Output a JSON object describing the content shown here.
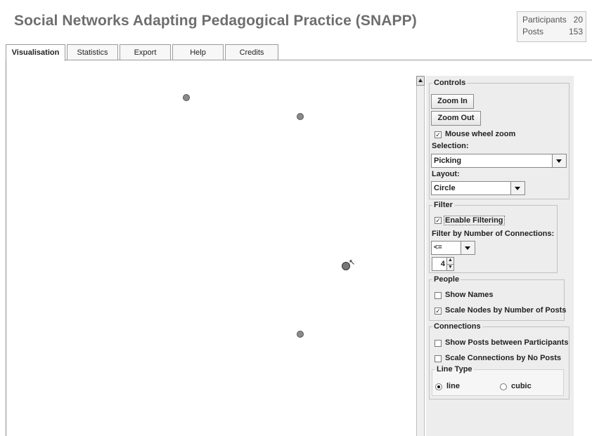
{
  "header": {
    "title": "Social Networks Adapting Pedagogical Practice (SNAPP)",
    "stats": {
      "participants_label": "Participants",
      "participants_value": "20",
      "posts_label": "Posts",
      "posts_value": "153"
    }
  },
  "tabs": [
    {
      "label": "Visualisation",
      "active": true
    },
    {
      "label": "Statistics",
      "active": false
    },
    {
      "label": "Export",
      "active": false
    },
    {
      "label": "Help",
      "active": false
    },
    {
      "label": "Credits",
      "active": false
    }
  ],
  "controls": {
    "legend": "Controls",
    "zoom_in": "Zoom In",
    "zoom_out": "Zoom Out",
    "mouse_wheel_zoom": {
      "label": "Mouse wheel zoom",
      "checked": true
    },
    "selection_label": "Selection:",
    "selection_value": "Picking",
    "layout_label": "Layout:",
    "layout_value": "Circle"
  },
  "filter": {
    "legend": "Filter",
    "enable_filtering": {
      "label": "Enable Filtering",
      "checked": true
    },
    "by_connections_label": "Filter by Number of Connections:",
    "operator_value": "<=",
    "count_value": "4"
  },
  "people": {
    "legend": "People",
    "show_names": {
      "label": "Show Names",
      "checked": false
    },
    "scale_nodes": {
      "label": "Scale Nodes by Number of Posts",
      "checked": true
    }
  },
  "connections": {
    "legend": "Connections",
    "show_posts": {
      "label": "Show Posts between Participants",
      "checked": false
    },
    "scale_connections": {
      "label": "Scale Connections by No Posts",
      "checked": false
    },
    "line_type": {
      "legend": "Line Type",
      "options": [
        "line",
        "cubic"
      ],
      "selected": "line"
    }
  },
  "colors": {
    "title": "#6e6e6e",
    "panel_bg": "#ededed",
    "node_fill": "#8a8a8a"
  }
}
